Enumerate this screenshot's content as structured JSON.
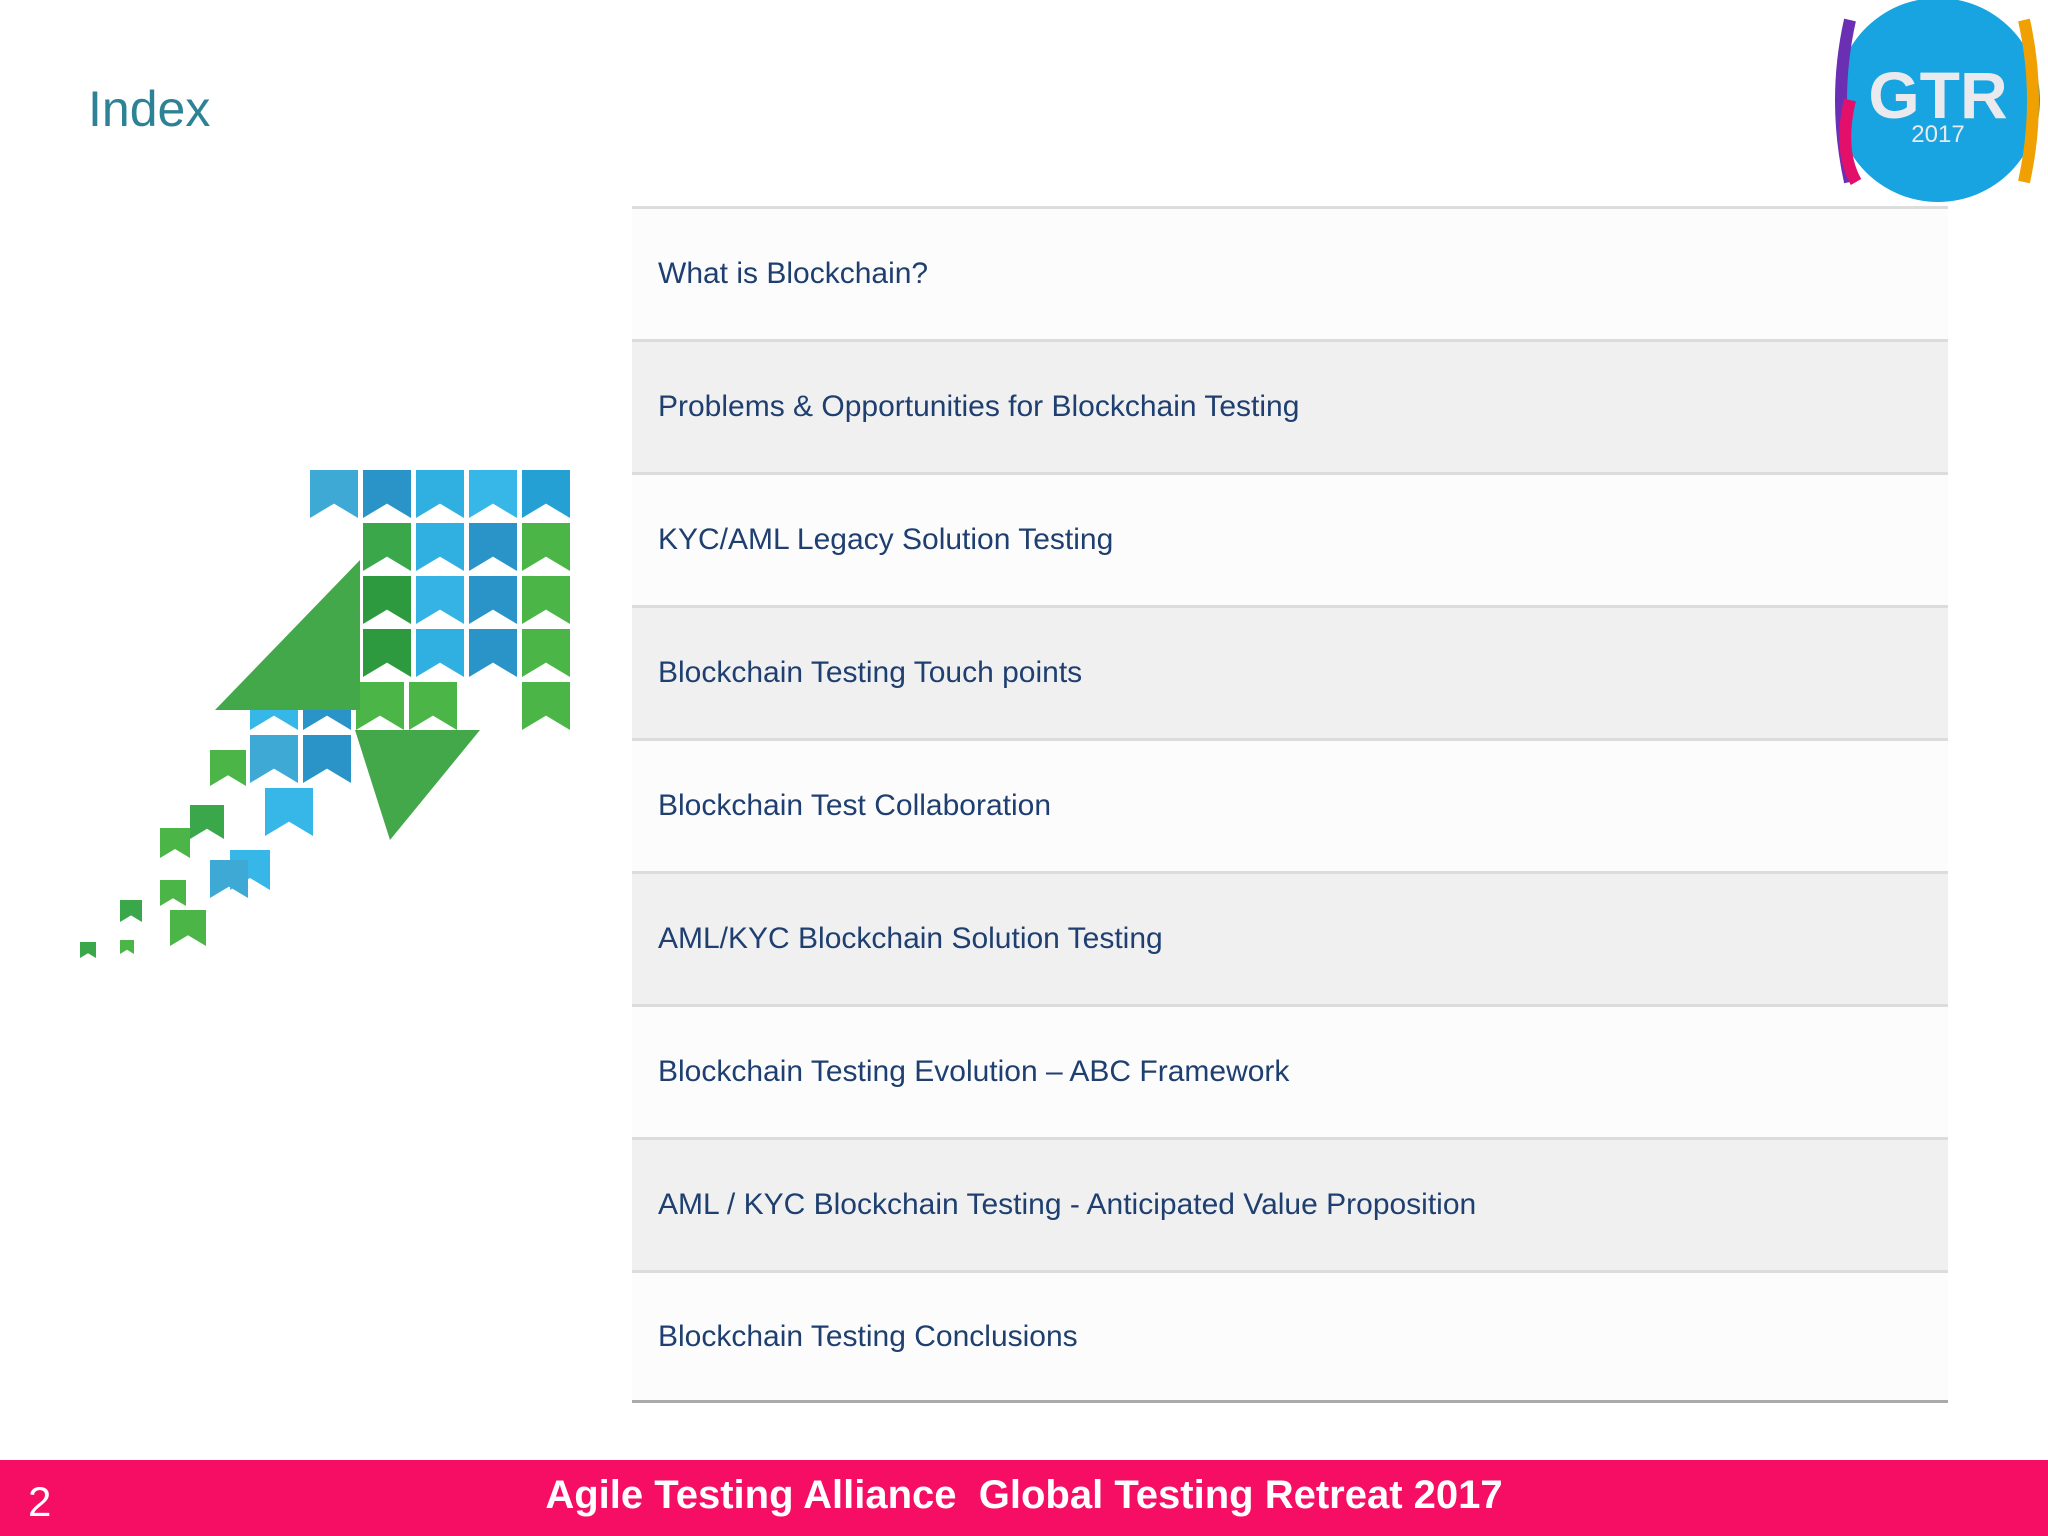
{
  "slide": {
    "title": "Index",
    "logo": {
      "text": "GTR",
      "year": "2017"
    },
    "items": [
      "What is Blockchain?",
      "Problems & Opportunities for Blockchain Testing",
      "KYC/AML Legacy Solution Testing",
      "Blockchain Testing Touch points",
      "Blockchain Test Collaboration",
      "AML/KYC Blockchain Solution Testing",
      "Blockchain Testing Evolution – ABC Framework",
      "AML / KYC Blockchain Testing - Anticipated Value Proposition",
      "Blockchain Testing Conclusions"
    ]
  },
  "footer": {
    "page_number": "2",
    "text": "Agile Testing Alliance  Global Testing Retreat 2017",
    "color": "#f50e64"
  }
}
